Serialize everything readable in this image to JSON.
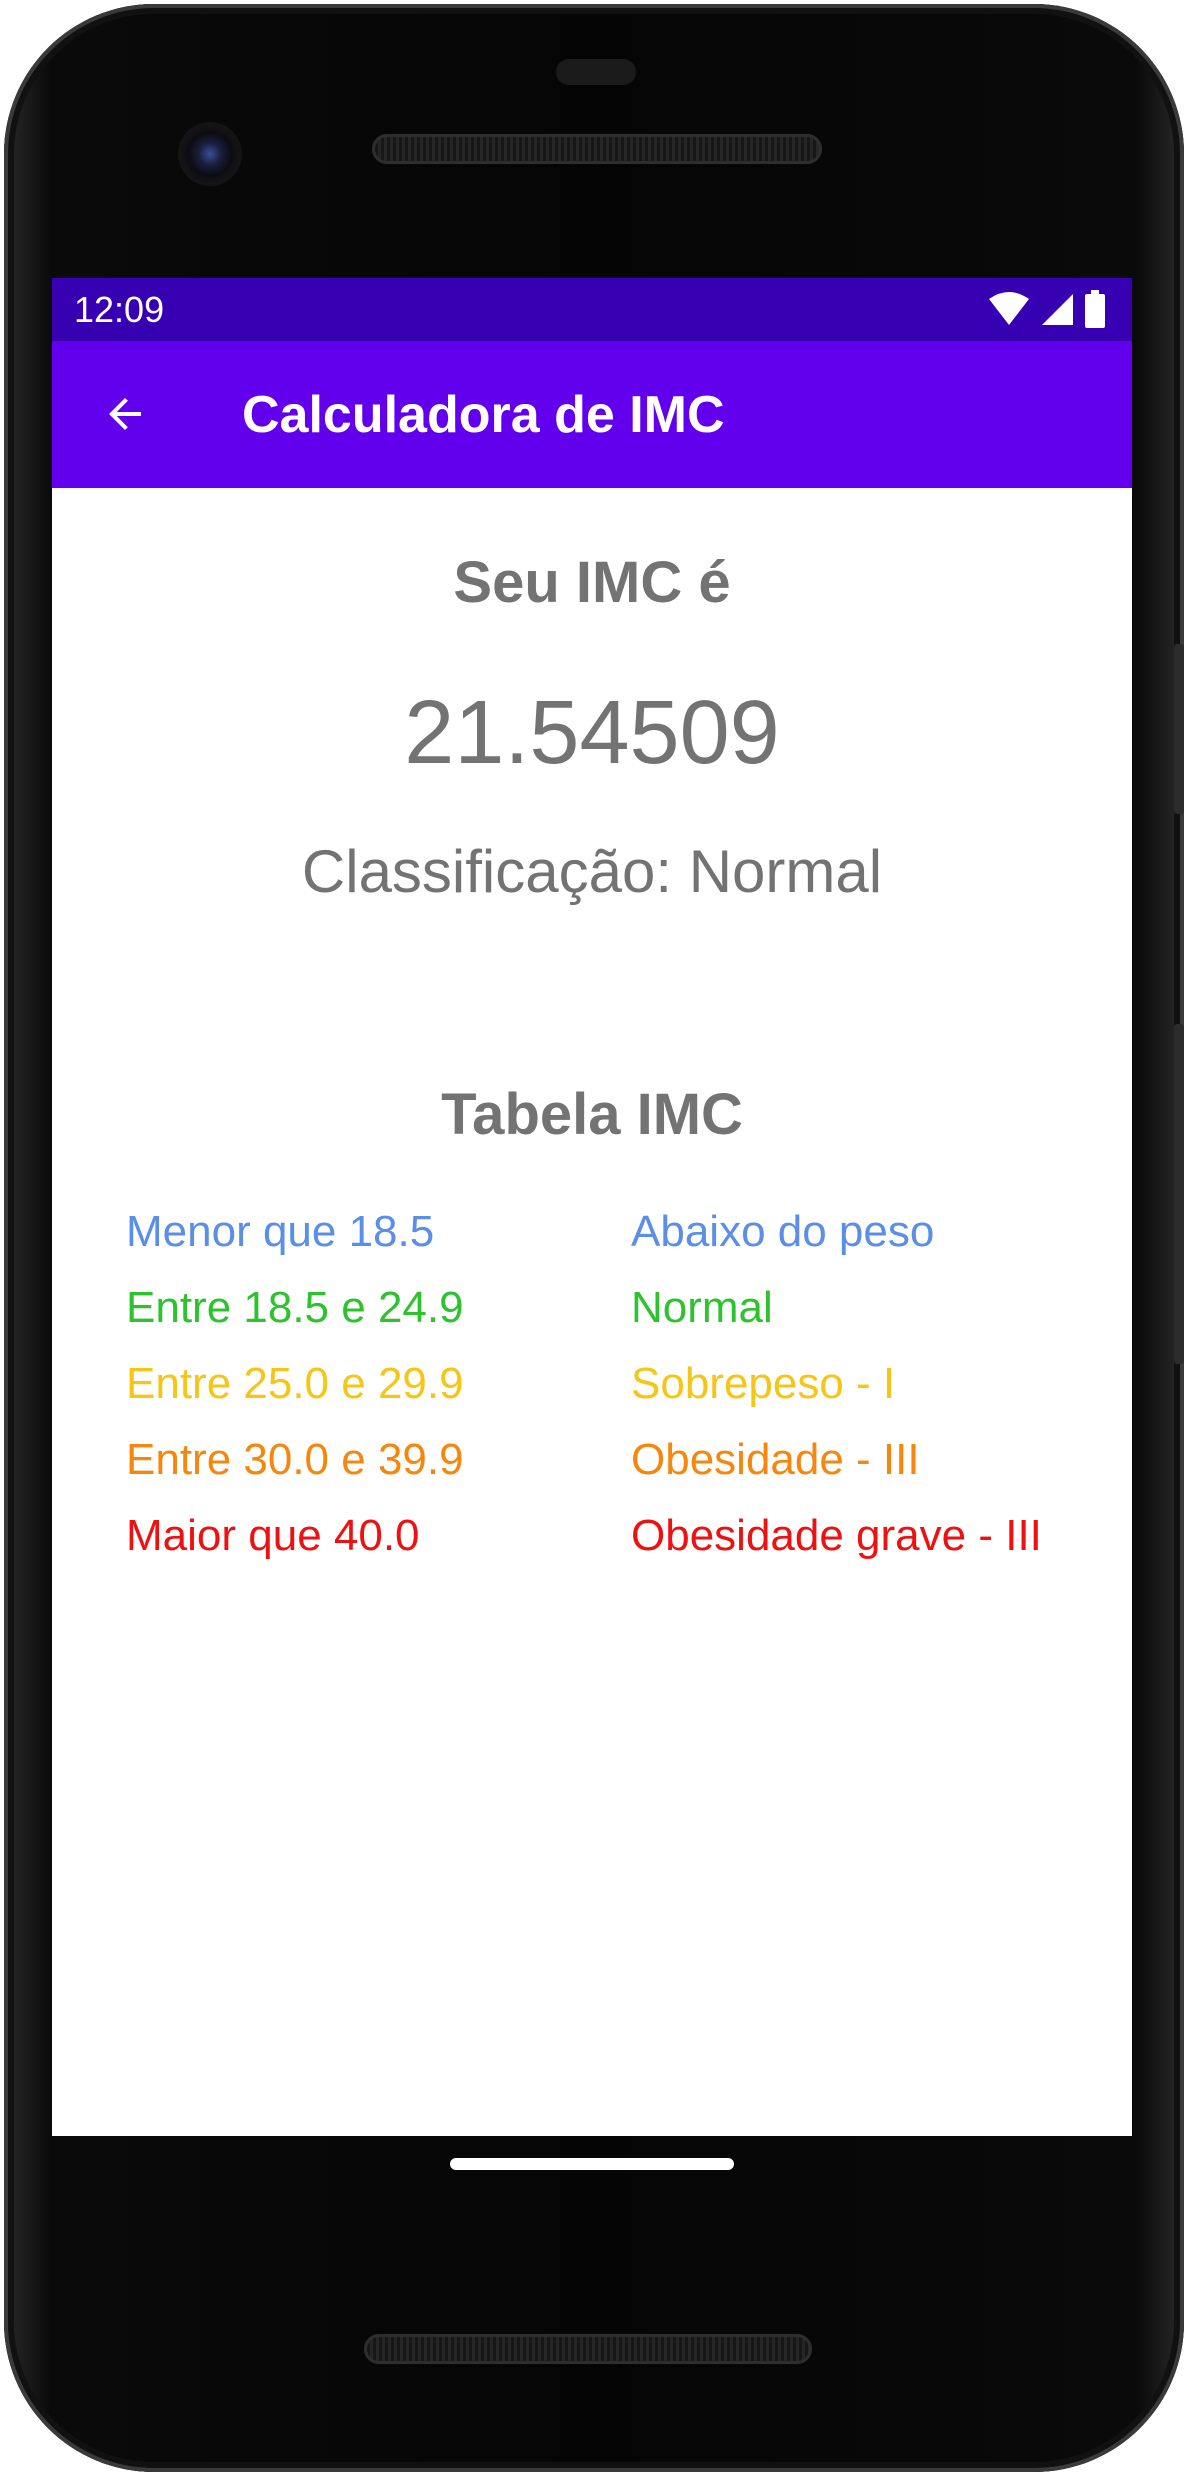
{
  "status_bar": {
    "time": "12:09",
    "icons": [
      "wifi-icon",
      "cell-signal-icon",
      "battery-icon"
    ],
    "color": "#3700b3"
  },
  "app_bar": {
    "title": "Calculadora de IMC",
    "back_icon": "arrow-back-icon",
    "color": "#6200ee"
  },
  "result": {
    "label": "Seu IMC é",
    "value": "21.54509",
    "classification": "Classificação: Normal",
    "text_color": "#737373"
  },
  "table": {
    "title": "Tabela IMC",
    "rows": [
      {
        "range": "Menor que 18.5",
        "class": "Abaixo do peso",
        "color": "#5b8ee6"
      },
      {
        "range": "Entre 18.5 e 24.9",
        "class": "Normal",
        "color": "#2ec22e"
      },
      {
        "range": "Entre 25.0 e 29.9",
        "class": "Sobrepeso - I",
        "color": "#f5c518"
      },
      {
        "range": "Entre 30.0 e 39.9",
        "class": "Obesidade - III",
        "color": "#f5870f"
      },
      {
        "range": "Maior que 40.0",
        "class": "Obesidade grave - III",
        "color": "#ee1111"
      }
    ]
  }
}
